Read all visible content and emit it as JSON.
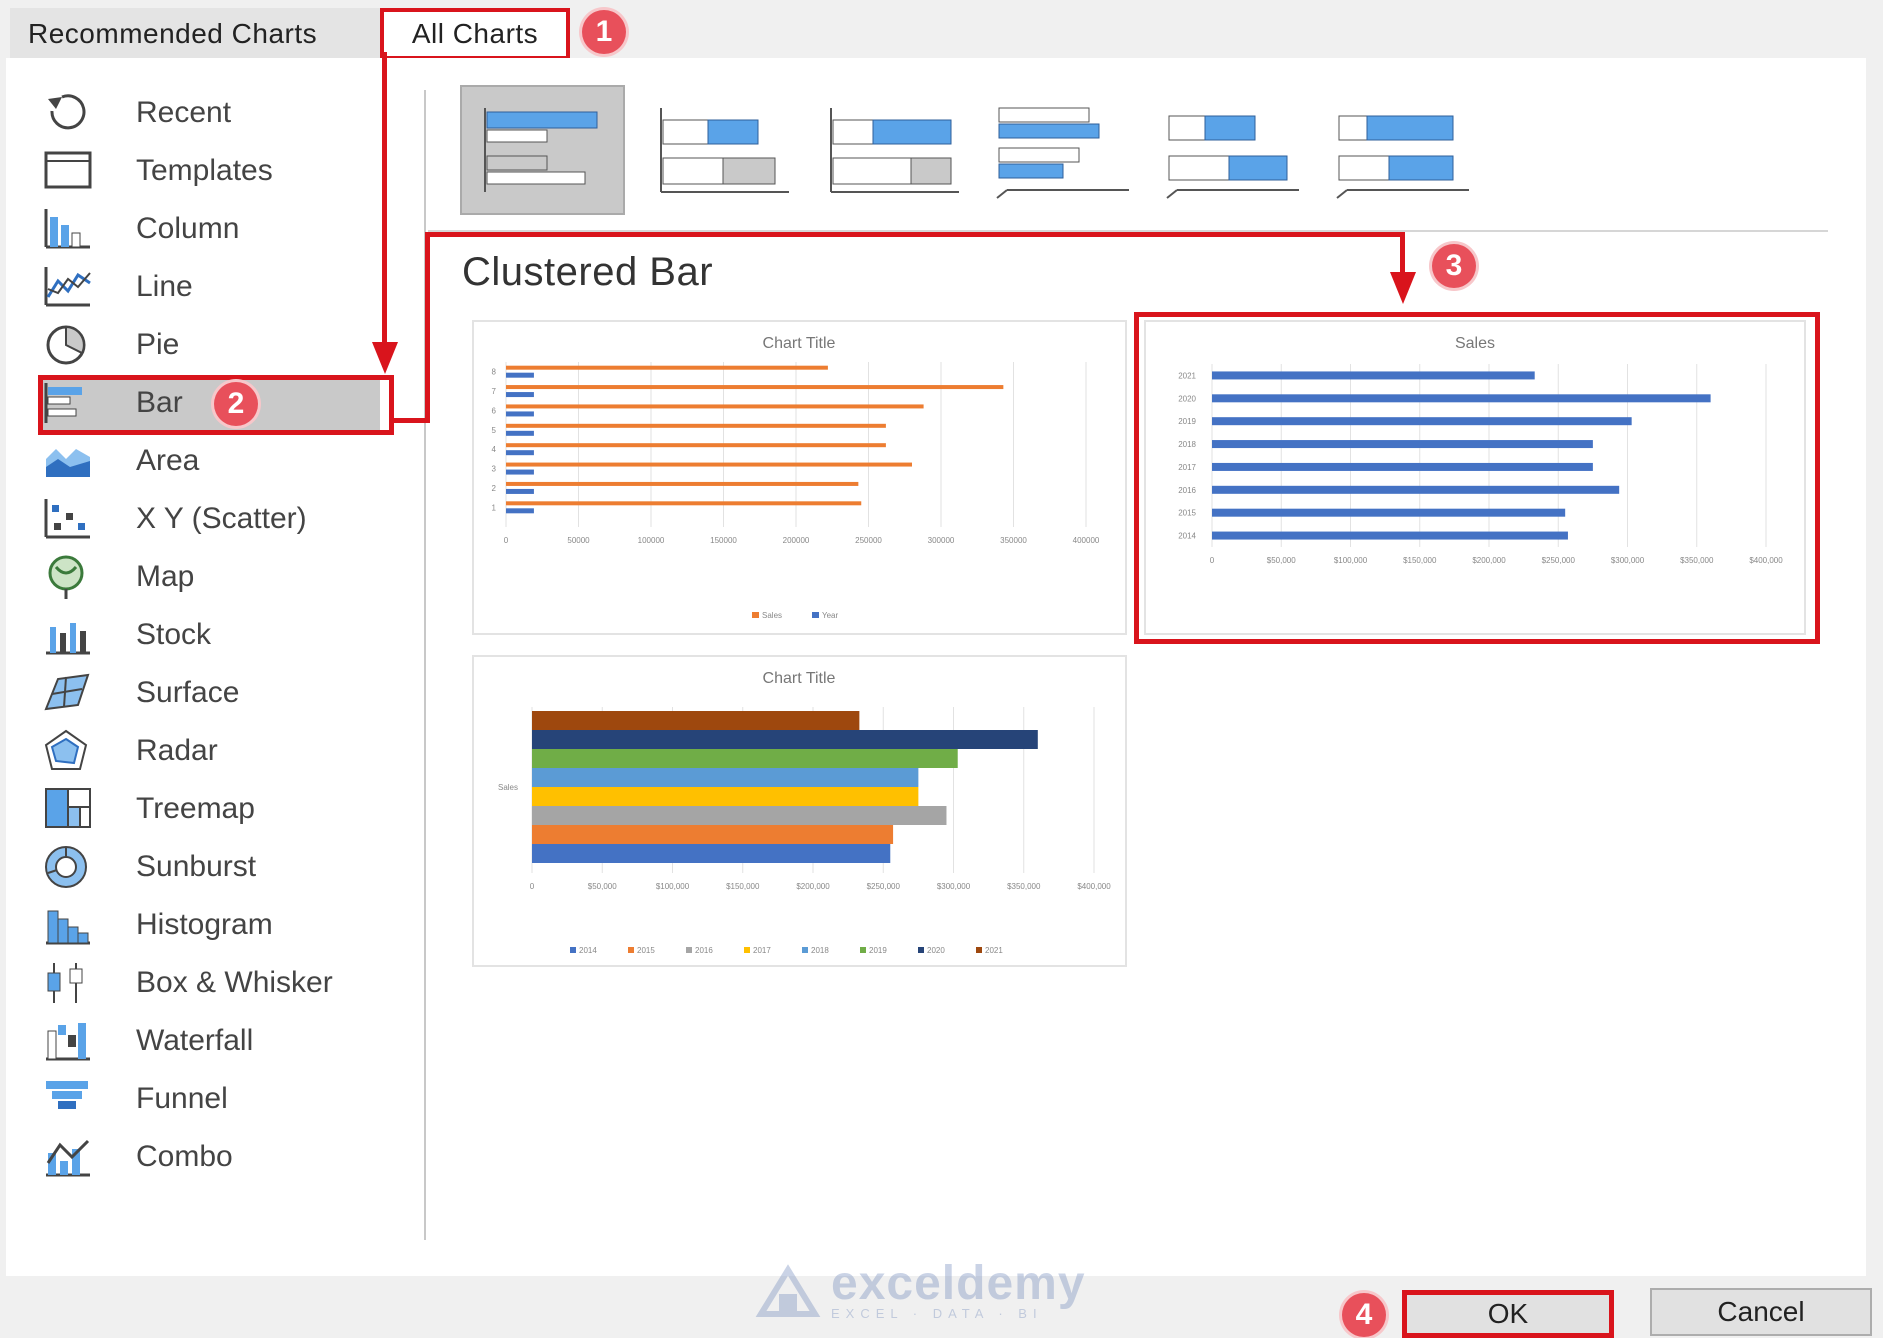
{
  "tabs": {
    "recommended": "Recommended Charts",
    "all": "All Charts"
  },
  "badges": {
    "b1": "1",
    "b2": "2",
    "b3": "3",
    "b4": "4"
  },
  "nav_items": [
    {
      "label": "Recent",
      "icon": "recent-icon"
    },
    {
      "label": "Templates",
      "icon": "templates-icon"
    },
    {
      "label": "Column",
      "icon": "column-chart-icon"
    },
    {
      "label": "Line",
      "icon": "line-chart-icon"
    },
    {
      "label": "Pie",
      "icon": "pie-chart-icon"
    },
    {
      "label": "Bar",
      "icon": "bar-chart-icon"
    },
    {
      "label": "Area",
      "icon": "area-chart-icon"
    },
    {
      "label": "X Y (Scatter)",
      "icon": "scatter-chart-icon"
    },
    {
      "label": "Map",
      "icon": "map-chart-icon"
    },
    {
      "label": "Stock",
      "icon": "stock-chart-icon"
    },
    {
      "label": "Surface",
      "icon": "surface-chart-icon"
    },
    {
      "label": "Radar",
      "icon": "radar-chart-icon"
    },
    {
      "label": "Treemap",
      "icon": "treemap-icon"
    },
    {
      "label": "Sunburst",
      "icon": "sunburst-icon"
    },
    {
      "label": "Histogram",
      "icon": "histogram-icon"
    },
    {
      "label": "Box & Whisker",
      "icon": "box-whisker-icon"
    },
    {
      "label": "Waterfall",
      "icon": "waterfall-icon"
    },
    {
      "label": "Funnel",
      "icon": "funnel-icon"
    },
    {
      "label": "Combo",
      "icon": "combo-chart-icon"
    }
  ],
  "selected_nav": "Bar",
  "subtypes": [
    "clustered-bar",
    "stacked-bar",
    "100-stacked-bar",
    "3d-clustered-bar",
    "3d-stacked-bar",
    "3d-100-stacked-bar"
  ],
  "selected_subtype_title": "Clustered Bar",
  "buttons": {
    "ok": "OK",
    "cancel": "Cancel"
  },
  "watermark": {
    "name": "exceldemy",
    "tagline": "EXCEL · DATA · BI"
  },
  "colors": {
    "accent_red": "#d9141c",
    "badge": "#e8505b",
    "excel_orange": "#ed7d31",
    "excel_blue": "#4472c4"
  },
  "chart_data": [
    {
      "type": "bar",
      "title": "Chart Title",
      "categories": [
        "1",
        "2",
        "3",
        "4",
        "5",
        "6",
        "7",
        "8"
      ],
      "series": [
        {
          "name": "Sales",
          "values": [
            245000,
            243000,
            280000,
            262000,
            262000,
            288000,
            343000,
            222000
          ]
        },
        {
          "name": "Year",
          "values": [
            2014,
            2015,
            2016,
            2017,
            2018,
            2019,
            2020,
            2021
          ]
        }
      ],
      "xlim": [
        0,
        400000
      ],
      "xticks": [
        "0",
        "50000",
        "100000",
        "150000",
        "200000",
        "250000",
        "300000",
        "350000",
        "400000"
      ],
      "legend": "bottom"
    },
    {
      "type": "bar",
      "title": "Sales",
      "categories": [
        "2014",
        "2015",
        "2016",
        "2017",
        "2018",
        "2019",
        "2020",
        "2021"
      ],
      "series": [
        {
          "name": "Sales",
          "values": [
            257000,
            255000,
            294000,
            275000,
            275000,
            303000,
            360000,
            233000
          ]
        }
      ],
      "xlim": [
        0,
        400000
      ],
      "xticks": [
        "0",
        "$50,000",
        "$100,000",
        "$150,000",
        "$200,000",
        "$250,000",
        "$300,000",
        "$350,000",
        "$400,000"
      ],
      "legend": "none"
    },
    {
      "type": "bar",
      "title": "Chart Title",
      "categories": [
        "Sales"
      ],
      "series": [
        {
          "name": "2014",
          "values": [
            255000
          ]
        },
        {
          "name": "2015",
          "values": [
            257000
          ]
        },
        {
          "name": "2016",
          "values": [
            295000
          ]
        },
        {
          "name": "2017",
          "values": [
            275000
          ]
        },
        {
          "name": "2018",
          "values": [
            275000
          ]
        },
        {
          "name": "2019",
          "values": [
            303000
          ]
        },
        {
          "name": "2020",
          "values": [
            360000
          ]
        },
        {
          "name": "2021",
          "values": [
            233000
          ]
        }
      ],
      "xlim": [
        0,
        400000
      ],
      "xticks": [
        "0",
        "$50,000",
        "$100,000",
        "$150,000",
        "$200,000",
        "$250,000",
        "$300,000",
        "$350,000",
        "$400,000"
      ],
      "legend": "bottom"
    }
  ]
}
